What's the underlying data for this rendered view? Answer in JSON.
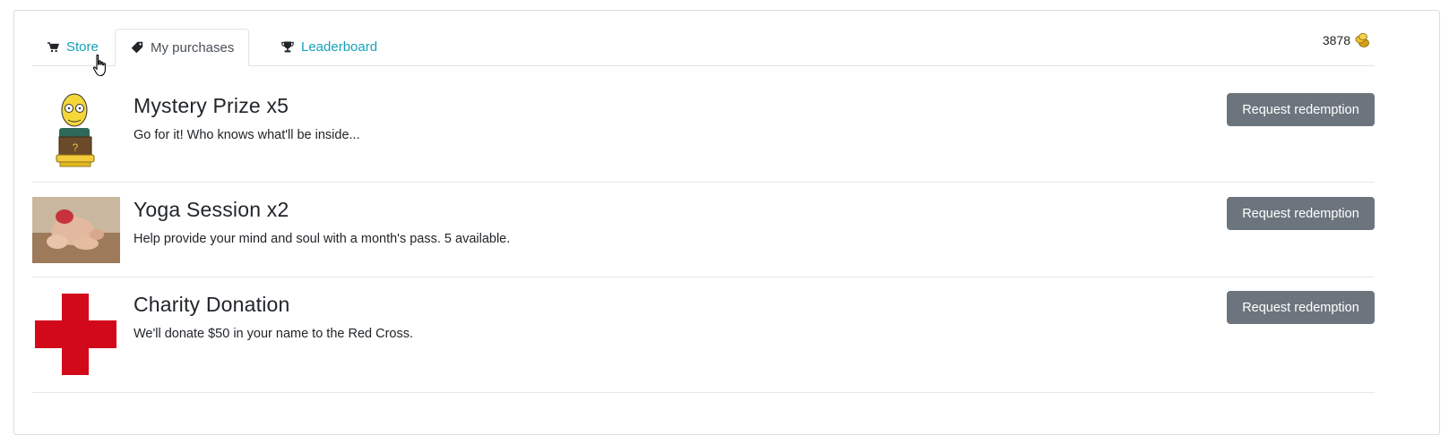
{
  "tabs": [
    {
      "label": "Store",
      "icon": "cart-icon",
      "active": false
    },
    {
      "label": "My purchases",
      "icon": "tag-icon",
      "active": true
    },
    {
      "label": "Leaderboard",
      "icon": "trophy-icon",
      "active": false
    }
  ],
  "balance": {
    "amount": "3878",
    "icon": "coins-icon"
  },
  "items": [
    {
      "title": "Mystery Prize x5",
      "description": "Go for it! Who knows what'll be inside...",
      "image": "mystery-prize-image",
      "button": "Request redemption"
    },
    {
      "title": "Yoga Session x2",
      "description": "Help provide your mind and soul with a month's pass. 5 available.",
      "image": "yoga-image",
      "button": "Request redemption"
    },
    {
      "title": "Charity Donation",
      "description": "We'll donate $50 in your name to the Red Cross.",
      "image": "red-cross-image",
      "button": "Request redemption"
    }
  ],
  "colors": {
    "link": "#17a2b8",
    "button_bg": "#6c757d",
    "red_cross": "#d2091a"
  }
}
